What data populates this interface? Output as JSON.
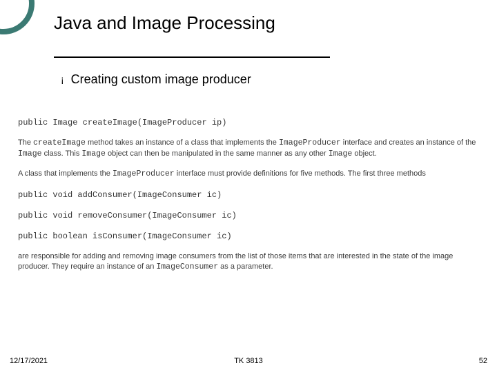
{
  "slide": {
    "title": "Java and Image Processing",
    "bullet": {
      "marker": "¡",
      "text": "Creating custom image producer"
    },
    "body": {
      "sig_create": "public Image createImage(ImageProducer ip)",
      "para1_a": "The ",
      "para1_b": "createImage",
      "para1_c": " method takes an instance of a class that implements the ",
      "para1_d": "ImageProducer",
      "para1_e": " interface and creates an instance of the ",
      "para1_f": "Image",
      "para1_g": " class. This ",
      "para1_h": "Image",
      "para1_i": " object can then be manipulated in the same manner as any other ",
      "para1_j": "Image",
      "para1_k": " object.",
      "para2_a": "A class that implements the ",
      "para2_b": "ImageProducer",
      "para2_c": " interface must provide definitions for five methods. The first three methods",
      "sig_add": "public void addConsumer(ImageConsumer ic)",
      "sig_remove": "public void removeConsumer(ImageConsumer ic)",
      "sig_is": "public boolean isConsumer(ImageConsumer ic)",
      "para3_a": "are responsible for adding and removing image consumers from the list of those items that are interested in the state of the image producer. They require an instance of an ",
      "para3_b": "ImageConsumer",
      "para3_c": " as a parameter."
    },
    "footer": {
      "date": "12/17/2021",
      "center": "TK 3813",
      "page": "52"
    }
  }
}
